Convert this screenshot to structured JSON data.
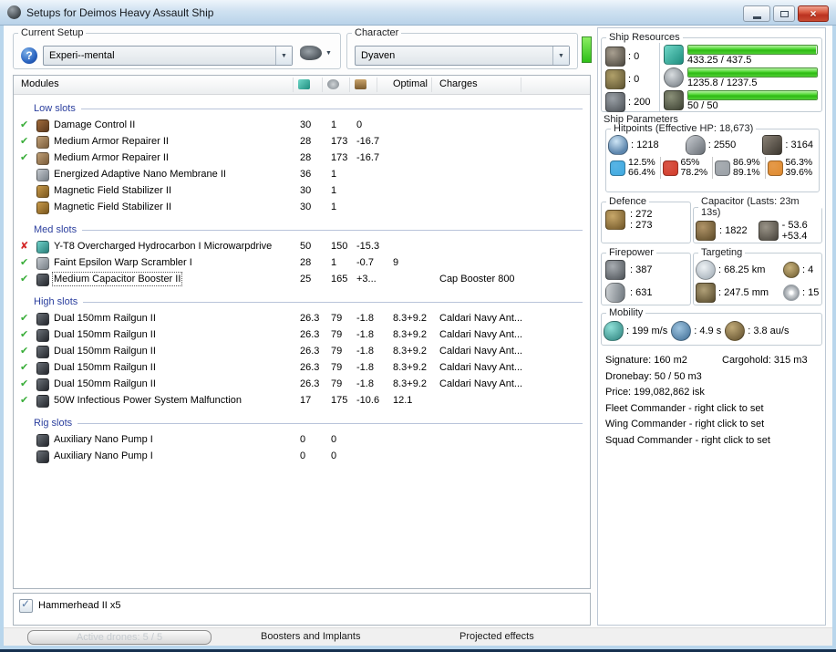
{
  "window": {
    "title": "Setups for Deimos Heavy Assault Ship"
  },
  "toolbar": {
    "current_setup_label": "Current Setup",
    "current_setup_value": "Experi--mental",
    "character_label": "Character",
    "character_value": "Dyaven"
  },
  "table": {
    "modules_header": "Modules",
    "optimal_header": "Optimal",
    "charges_header": "Charges",
    "sections": [
      {
        "label": "Low slots",
        "rows": [
          {
            "status": "ok",
            "tint": "brown",
            "name": "Damage Control II",
            "cpu": "30",
            "pg": "1",
            "cap": "0"
          },
          {
            "status": "ok",
            "tint": "tan",
            "name": "Medium Armor Repairer II",
            "cpu": "28",
            "pg": "173",
            "cap": "-16.7"
          },
          {
            "status": "ok",
            "tint": "tan",
            "name": "Medium Armor Repairer II",
            "cpu": "28",
            "pg": "173",
            "cap": "-16.7"
          },
          {
            "status": "none",
            "tint": "silver",
            "name": "Energized Adaptive Nano Membrane II",
            "cpu": "36",
            "pg": "1"
          },
          {
            "status": "none",
            "tint": "gold",
            "name": "Magnetic Field Stabilizer II",
            "cpu": "30",
            "pg": "1"
          },
          {
            "status": "none",
            "tint": "gold",
            "name": "Magnetic Field Stabilizer II",
            "cpu": "30",
            "pg": "1"
          }
        ]
      },
      {
        "label": "Med slots",
        "rows": [
          {
            "status": "bad",
            "tint": "teal",
            "name": "Y-T8 Overcharged Hydrocarbon I Microwarpdrive",
            "cpu": "50",
            "pg": "150",
            "cap": "-15.3"
          },
          {
            "status": "ok",
            "tint": "silver",
            "name": "Faint Epsilon Warp Scrambler I",
            "cpu": "28",
            "pg": "1",
            "cap": "-0.7",
            "optimal": "9"
          },
          {
            "status": "ok",
            "tint": "dark",
            "name": "Medium Capacitor Booster II",
            "cpu": "25",
            "pg": "165",
            "cap": "+3...",
            "charges": "Cap Booster 800",
            "selected": true
          }
        ]
      },
      {
        "label": "High slots",
        "rows": [
          {
            "status": "ok",
            "tint": "dark",
            "name": "Dual 150mm Railgun II",
            "cpu": "26.3",
            "pg": "79",
            "cap": "-1.8",
            "optimal": "8.3+9.2",
            "charges": "Caldari Navy Ant..."
          },
          {
            "status": "ok",
            "tint": "dark",
            "name": "Dual 150mm Railgun II",
            "cpu": "26.3",
            "pg": "79",
            "cap": "-1.8",
            "optimal": "8.3+9.2",
            "charges": "Caldari Navy Ant..."
          },
          {
            "status": "ok",
            "tint": "dark",
            "name": "Dual 150mm Railgun II",
            "cpu": "26.3",
            "pg": "79",
            "cap": "-1.8",
            "optimal": "8.3+9.2",
            "charges": "Caldari Navy Ant..."
          },
          {
            "status": "ok",
            "tint": "dark",
            "name": "Dual 150mm Railgun II",
            "cpu": "26.3",
            "pg": "79",
            "cap": "-1.8",
            "optimal": "8.3+9.2",
            "charges": "Caldari Navy Ant..."
          },
          {
            "status": "ok",
            "tint": "dark",
            "name": "Dual 150mm Railgun II",
            "cpu": "26.3",
            "pg": "79",
            "cap": "-1.8",
            "optimal": "8.3+9.2",
            "charges": "Caldari Navy Ant..."
          },
          {
            "status": "ok",
            "tint": "dark",
            "name": "50W Infectious Power System Malfunction",
            "cpu": "17",
            "pg": "175",
            "cap": "-10.6",
            "optimal": "12.1"
          }
        ]
      },
      {
        "label": "Rig slots",
        "rows": [
          {
            "status": "none",
            "tint": "dark",
            "name": "Auxiliary Nano Pump I",
            "cpu": "0",
            "pg": "0"
          },
          {
            "status": "none",
            "tint": "dark",
            "name": "Auxiliary Nano Pump I",
            "cpu": "0",
            "pg": "0"
          }
        ]
      }
    ]
  },
  "drones": {
    "items": [
      {
        "checked": true,
        "label": "Hammerhead II x5"
      }
    ]
  },
  "footer": {
    "active_drones": "Active drones: 5 / 5",
    "boosters_tab": "Boosters and Implants",
    "projected_tab": "Projected effects"
  },
  "ship_resources": {
    "label": "Ship Resources",
    "turrets": ": 0",
    "launchers": ": 0",
    "calibration": ": 200",
    "bars": [
      {
        "icon": "cpu-icon",
        "text": "433.25 / 437.5",
        "pct": 99
      },
      {
        "icon": "powergrid-icon",
        "text": "1235.8 / 1237.5",
        "pct": 99.9
      },
      {
        "icon": "dronebay-icon",
        "text": "50 / 50",
        "pct": 100
      }
    ]
  },
  "ship_parameters": {
    "label": "Ship Parameters",
    "hitpoints": {
      "label": "Hitpoints (Effective HP: 18,673)",
      "shield": ": 1218",
      "armor": ": 2550",
      "structure": ": 3164",
      "resists": [
        {
          "type": "em",
          "top": "12.5%",
          "bottom": "66.4%",
          "color": "#3fa9e0"
        },
        {
          "type": "thermal",
          "top": "65%",
          "bottom": "78.2%",
          "color": "#d23b2a"
        },
        {
          "type": "kinetic",
          "top": "86.9%",
          "bottom": "89.1%",
          "color": "#9aa0a6"
        },
        {
          "type": "explosive",
          "top": "56.3%",
          "bottom": "39.6%",
          "color": "#e08a2e"
        }
      ]
    },
    "defence": {
      "label": "Defence",
      "value_top": ": 272",
      "value_bottom": ": 273"
    },
    "capacitor": {
      "label": "Capacitor (Lasts: 23m 13s)",
      "amount": ": 1822",
      "delta_top": "- 53.6",
      "delta_bottom": "+53.4"
    },
    "firepower": {
      "label": "Firepower",
      "dps": ": 387",
      "volley": ": 631"
    },
    "targeting": {
      "label": "Targeting",
      "range": ": 68.25 km",
      "max_targets": ": 4",
      "resolution": ": 247.5 mm",
      "sensor_strength": ": 15"
    },
    "mobility": {
      "label": "Mobility",
      "speed": ": 199 m/s",
      "align": ": 4.9 s",
      "warp": ": 3.8 au/s"
    },
    "info": {
      "signature": "Signature: 160 m2",
      "cargohold": "Cargohold: 315 m3",
      "dronebay": "Dronebay: 50 / 50 m3",
      "price": "Price: 199,082,862 isk",
      "fleet": "Fleet Commander - right click to set",
      "wing": "Wing Commander - right click to set",
      "squad": "Squad Commander - right click to set"
    }
  }
}
